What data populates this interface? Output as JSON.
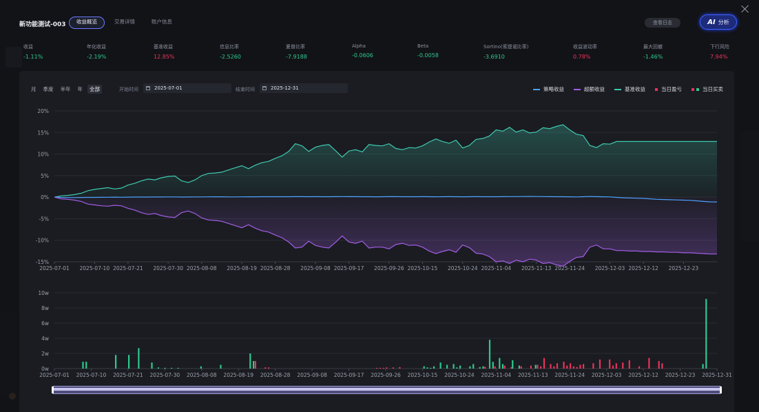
{
  "header": {
    "title": "新功能测试-003",
    "tabs": [
      {
        "label": "收益概览",
        "active": true
      },
      {
        "label": "交易详情",
        "active": false
      },
      {
        "label": "账户信息",
        "active": false
      }
    ],
    "log_button": "查看日志",
    "ai_icon": "AI",
    "ai_button": "分析"
  },
  "metrics": [
    {
      "label": "收益",
      "value": "-1.11%",
      "trend": "down"
    },
    {
      "label": "年化收益",
      "value": "-2.19%",
      "trend": "down"
    },
    {
      "label": "基准收益",
      "value": "12.85%",
      "trend": "up"
    },
    {
      "label": "信息比率",
      "value": "-2.5260",
      "trend": "down"
    },
    {
      "label": "夏普比率",
      "value": "-7.9188",
      "trend": "down"
    },
    {
      "label": "Alpha",
      "value": "-0.0606",
      "trend": "down"
    },
    {
      "label": "Beta",
      "value": "-0.0058",
      "trend": "down"
    },
    {
      "label": "Sortino(索提诺比率)",
      "value": "-3.6910",
      "trend": "down"
    },
    {
      "label": "收益波动率",
      "value": "0.78%",
      "trend": "up"
    },
    {
      "label": "最大回撤",
      "value": "-1.46%",
      "trend": "down"
    },
    {
      "label": "下行风险",
      "value": "7.94%",
      "trend": "up"
    }
  ],
  "filters": {
    "periods": [
      {
        "label": "月",
        "active": false
      },
      {
        "label": "季度",
        "active": false
      },
      {
        "label": "半年",
        "active": false
      },
      {
        "label": "年",
        "active": false
      },
      {
        "label": "全部",
        "active": true
      }
    ],
    "start_label": "开始时间",
    "start_value": "2025-07-01",
    "end_label": "结束时间",
    "end_value": "2025-12-31"
  },
  "legend": [
    {
      "label": "策略收益",
      "kind": "line",
      "colors": [
        "#4aa3ff"
      ]
    },
    {
      "label": "超额收益",
      "kind": "line",
      "colors": [
        "#a45ee8"
      ]
    },
    {
      "label": "基准收益",
      "kind": "line",
      "colors": [
        "#3fcab0"
      ]
    },
    {
      "label": "当日盈亏",
      "kind": "squares",
      "colors": [
        "#e8335b",
        "#e8335b"
      ]
    },
    {
      "label": "当日买卖",
      "kind": "squares",
      "colors": [
        "#e8335b",
        "#2ec98d"
      ]
    }
  ],
  "colors": {
    "strategy": "#4aa3ff",
    "excess": "#a45ee8",
    "benchmark": "#3fcab0",
    "buy": "#2ec98d",
    "sell": "#e8335b"
  },
  "chart_data": [
    {
      "type": "line",
      "x_ticks": [
        "2025-07-01",
        "2025-07-10",
        "2025-07-21",
        "2025-07-30",
        "2025-08-08",
        "2025-08-19",
        "2025-08-28",
        "2025-09-08",
        "2025-09-17",
        "2025-09-26",
        "2025-10-15",
        "2025-10-24",
        "2025-11-04",
        "2025-11-13",
        "2025-11-24",
        "2025-12-03",
        "2025-12-12",
        "2025-12-23"
      ],
      "y_ticks": [
        "20%",
        "15%",
        "10%",
        "5%",
        "0%",
        "-5%",
        "-10%",
        "-15%"
      ],
      "ylim": [
        -15,
        20
      ],
      "series": [
        {
          "name": "基准收益",
          "values": [
            0,
            0.3,
            0.4,
            0.6,
            0.9,
            1.5,
            1.8,
            2.0,
            2.2,
            1.9,
            2.1,
            2.8,
            3.2,
            3.8,
            4.2,
            4.0,
            4.5,
            4.8,
            4.9,
            3.8,
            3.4,
            4.0,
            5.0,
            5.5,
            5.6,
            5.8,
            6.3,
            6.8,
            7.3,
            6.6,
            7.4,
            8.0,
            8.3,
            9.0,
            9.6,
            10.6,
            12.4,
            11.9,
            10.6,
            11.6,
            12.0,
            12.2,
            10.8,
            9.3,
            10.7,
            11.0,
            10.5,
            12.2,
            12.0,
            11.9,
            12.4,
            11.3,
            11.0,
            11.5,
            11.4,
            11.9,
            12.8,
            13.5,
            12.9,
            12.5,
            13.2,
            11.4,
            12.0,
            13.4,
            13.6,
            14.2,
            15.6,
            15.3,
            16.2,
            15.1,
            15.6,
            14.9,
            15.1,
            16.1,
            15.9,
            16.4,
            16.8,
            15.6,
            14.6,
            14.3,
            12.0,
            11.5,
            12.4,
            12.3,
            12.9,
            12.9,
            12.9,
            12.9,
            12.9,
            12.9,
            12.9,
            12.9,
            12.9,
            12.9,
            12.9,
            12.9,
            12.9,
            12.9,
            12.9,
            12.9
          ]
        },
        {
          "name": "策略收益",
          "values": [
            0,
            -0.05,
            -0.1,
            -0.1,
            -0.08,
            -0.05,
            -0.06,
            -0.04,
            -0.03,
            0,
            -0.02,
            0,
            0.02,
            0.02,
            0.03,
            0.05,
            0.04,
            0.05,
            0.06,
            0.03,
            0.04,
            0.05,
            0.06,
            0.07,
            0.08,
            0.08,
            0.06,
            0.05,
            0.07,
            0.08,
            0.09,
            0.1,
            0.1,
            0.11,
            0.1,
            0.11,
            0.12,
            0.12,
            0.11,
            0.12,
            0.1,
            0.11,
            0.12,
            0.13,
            0.12,
            0.12,
            0.11,
            0.1,
            0.09,
            0.1,
            0.12,
            0.13,
            0.11,
            0.1,
            0.11,
            0.12,
            0.1,
            0.09,
            0.11,
            0.12,
            0.1,
            0.09,
            0.1,
            0.12,
            0.11,
            0.1,
            0.11,
            0.12,
            0.13,
            0.14,
            0.15,
            0.16,
            0.15,
            0.14,
            0.12,
            0.11,
            0.1,
            0.08,
            0.06,
            0.1,
            0.15,
            0.12,
            0.08,
            0.05,
            -0.05,
            -0.15,
            -0.2,
            -0.25,
            -0.3,
            -0.4,
            -0.5,
            -0.55,
            -0.6,
            -0.65,
            -0.7,
            -0.75,
            -0.85,
            -1.0,
            -1.1,
            -1.11
          ]
        },
        {
          "name": "超额收益",
          "values": [
            0,
            -0.4,
            -0.5,
            -0.7,
            -1.0,
            -1.6,
            -1.8,
            -2.0,
            -2.1,
            -1.9,
            -2.0,
            -2.6,
            -3.0,
            -3.6,
            -4.0,
            -3.8,
            -4.3,
            -4.6,
            -4.7,
            -3.6,
            -3.2,
            -3.8,
            -4.8,
            -5.3,
            -5.4,
            -5.6,
            -6.1,
            -6.6,
            -7.1,
            -6.4,
            -7.2,
            -7.8,
            -8.1,
            -8.8,
            -9.4,
            -10.4,
            -11.8,
            -11.6,
            -10.2,
            -11.2,
            -11.6,
            -11.8,
            -10.5,
            -9.0,
            -10.4,
            -10.7,
            -10.2,
            -11.8,
            -11.6,
            -11.6,
            -12.0,
            -11.0,
            -10.7,
            -11.2,
            -11.1,
            -11.6,
            -12.5,
            -13.1,
            -12.6,
            -12.2,
            -12.8,
            -11.1,
            -11.7,
            -13.0,
            -13.2,
            -13.8,
            -15.0,
            -14.8,
            -15.4,
            -14.6,
            -15.0,
            -14.4,
            -14.6,
            -15.4,
            -15.2,
            -15.7,
            -16.0,
            -14.9,
            -14.0,
            -13.8,
            -11.6,
            -11.1,
            -12.0,
            -12.0,
            -12.4,
            -12.4,
            -12.5,
            -12.5,
            -12.6,
            -12.6,
            -12.7,
            -12.7,
            -12.8,
            -12.8,
            -12.9,
            -12.9,
            -13.0,
            -13.1,
            -13.2,
            -13.2
          ]
        }
      ]
    },
    {
      "type": "bar",
      "x_ticks": [
        "2025-07-01",
        "2025-07-10",
        "2025-07-21",
        "2025-07-30",
        "2025-08-08",
        "2025-08-19",
        "2025-08-28",
        "2025-09-08",
        "2025-09-17",
        "2025-09-26",
        "2025-10-15",
        "2025-10-24",
        "2025-11-04",
        "2025-11-13",
        "2025-11-24",
        "2025-12-03",
        "2025-12-12",
        "2025-12-23",
        "2025-12-31"
      ],
      "y_ticks": [
        "10w",
        "8w",
        "6w",
        "4w",
        "2w",
        "0w"
      ],
      "ylim": [
        0,
        100000
      ],
      "series": [
        {
          "name": "当日买入",
          "values": [
            0,
            0,
            0,
            0,
            0,
            0,
            0,
            0,
            0,
            9000,
            9000,
            0,
            0,
            0,
            0,
            0,
            0,
            0,
            0,
            18000,
            0,
            0,
            0,
            18000,
            0,
            0,
            27000,
            0,
            0,
            0,
            8000,
            0,
            1500,
            0,
            1000,
            0,
            1000,
            0,
            1000,
            0,
            0,
            0,
            0,
            0,
            0,
            3000,
            0,
            0,
            0,
            0,
            0,
            5000,
            0,
            0,
            0,
            0,
            0,
            0,
            0,
            0,
            20000,
            10000,
            0,
            0,
            0,
            0,
            0,
            0,
            0,
            0,
            0,
            0,
            0,
            0,
            0,
            0,
            0,
            0,
            0,
            0,
            0,
            0,
            0,
            0,
            0,
            0,
            0,
            0,
            0,
            0,
            0,
            0,
            0,
            0,
            0,
            0,
            0,
            0,
            0,
            0,
            0,
            0,
            0,
            0,
            0,
            0,
            0,
            0,
            0,
            0,
            0,
            0,
            0,
            3000,
            1500,
            1000,
            3000,
            0,
            8000,
            0,
            5000,
            0,
            6000,
            1500,
            4000,
            0,
            0,
            3000,
            6000,
            0,
            2000,
            3000,
            0,
            38000,
            9000,
            0,
            14000,
            6000,
            0,
            0,
            11000,
            0,
            4000,
            0,
            0,
            0,
            0,
            5000,
            0,
            0,
            0,
            0,
            0,
            0,
            0,
            0,
            0,
            0,
            0,
            0,
            0,
            0,
            0,
            0,
            0,
            0,
            0,
            0,
            0,
            0,
            0,
            0,
            0,
            0,
            0,
            0,
            0,
            0,
            0,
            0,
            0,
            0,
            0,
            0,
            0,
            0,
            0,
            0,
            0,
            0,
            0,
            0,
            0,
            0,
            0,
            0,
            0,
            0,
            6000,
            92000
          ]
        },
        {
          "name": "当日卖出",
          "values": [
            0,
            0,
            0,
            0,
            0,
            0,
            0,
            0,
            0,
            0,
            0,
            0,
            0,
            0,
            0,
            0,
            0,
            0,
            0,
            0,
            0,
            0,
            0,
            0,
            0,
            0,
            0,
            0,
            0,
            0,
            0,
            0,
            0,
            0,
            0,
            0,
            0,
            0,
            0,
            0,
            0,
            0,
            0,
            0,
            0,
            0,
            0,
            0,
            0,
            0,
            0,
            0,
            0,
            0,
            0,
            0,
            0,
            0,
            0,
            0,
            0,
            10000,
            0,
            0,
            1500,
            1500,
            0,
            0,
            0,
            0,
            0,
            0,
            0,
            0,
            0,
            0,
            0,
            0,
            0,
            0,
            0,
            0,
            0,
            0,
            0,
            0,
            0,
            0,
            0,
            0,
            0,
            0,
            0,
            0,
            0,
            0,
            0,
            0,
            1000,
            1000,
            1000,
            1500,
            0,
            1500,
            0,
            2000,
            0,
            0,
            0,
            0,
            0,
            0,
            0,
            0,
            0,
            0,
            0,
            0,
            0,
            0,
            0,
            0,
            0,
            0,
            0,
            0,
            0,
            0,
            0,
            0,
            0,
            2500,
            0,
            0,
            3000,
            0,
            0,
            4000,
            0,
            2000,
            0,
            0,
            3000,
            0,
            0,
            4000,
            0,
            5000,
            3000,
            14000,
            0,
            6000,
            3000,
            7000,
            0,
            9000,
            4000,
            7000,
            3000,
            2000,
            5000,
            6000,
            0,
            0,
            7000,
            0,
            12000,
            0,
            0,
            12000,
            4000,
            7000,
            0,
            8000,
            0,
            11000,
            0,
            0,
            3000,
            0,
            0,
            14000,
            0,
            0,
            10000,
            7000,
            0,
            0,
            0,
            0,
            0,
            0,
            0,
            0,
            0,
            0,
            0,
            0,
            0,
            0,
            0,
            0,
            0
          ]
        }
      ]
    }
  ]
}
